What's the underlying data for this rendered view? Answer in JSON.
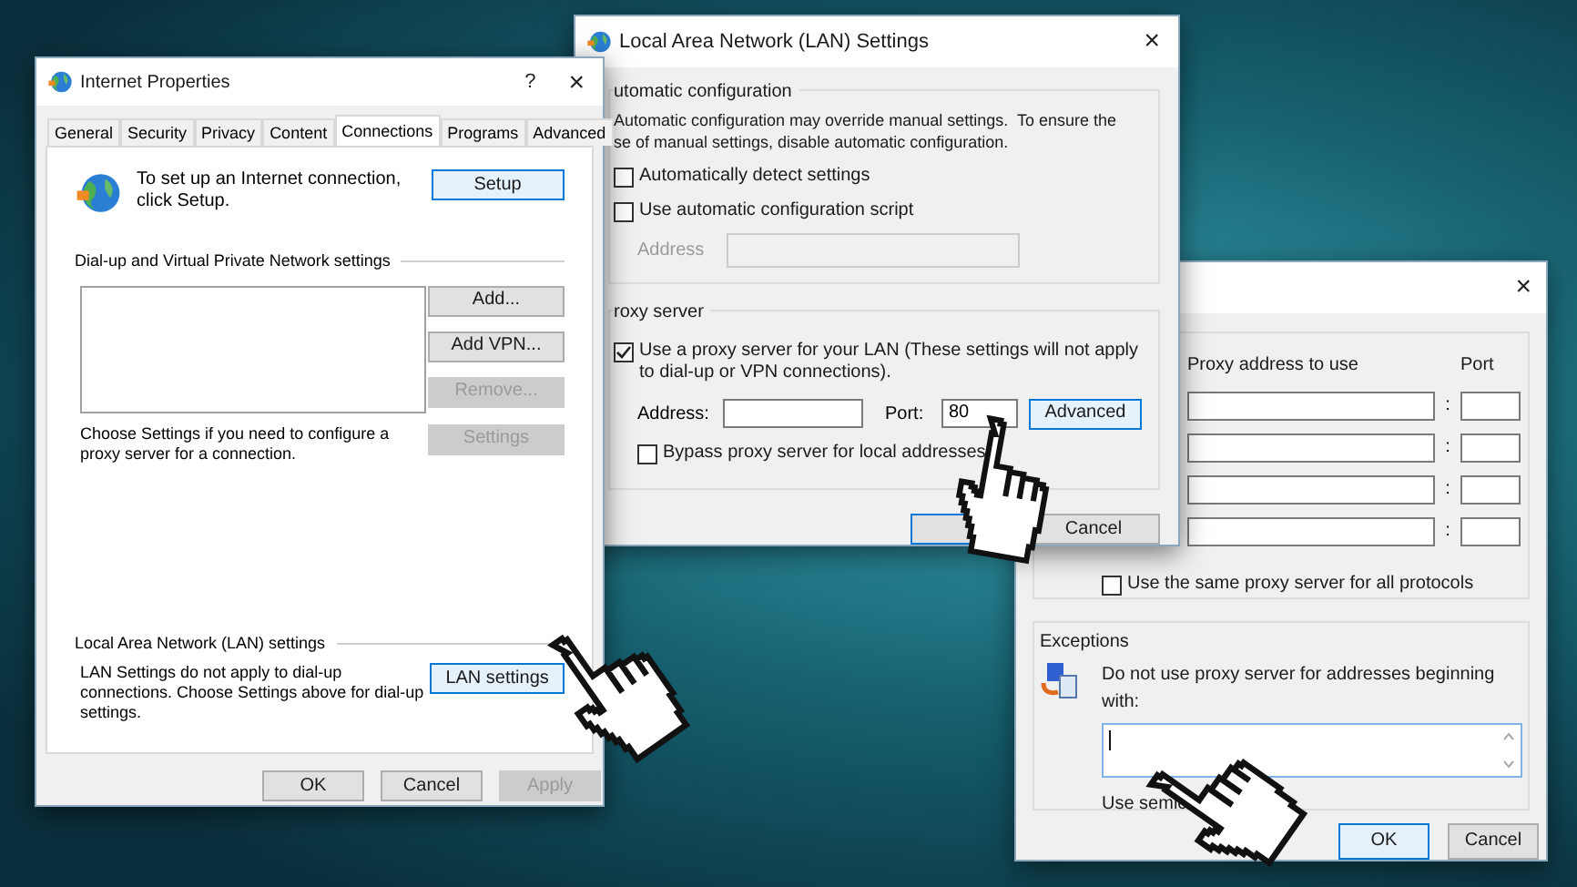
{
  "internet_properties": {
    "title": "Internet Properties",
    "help": "?",
    "close": "×",
    "tabs": [
      {
        "label": "General",
        "selected": false
      },
      {
        "label": "Security",
        "selected": false
      },
      {
        "label": "Privacy",
        "selected": false
      },
      {
        "label": "Content",
        "selected": false
      },
      {
        "label": "Connections",
        "selected": true
      },
      {
        "label": "Programs",
        "selected": false
      },
      {
        "label": "Advanced",
        "selected": false
      }
    ],
    "setup_text": "To set up an Internet connection, click Setup.",
    "setup_button": "Setup",
    "dialup_heading": "Dial-up and Virtual Private Network settings",
    "dialup_buttons": [
      {
        "label": "Add...",
        "disabled": false
      },
      {
        "label": "Add VPN...",
        "disabled": false
      },
      {
        "label": "Remove...",
        "disabled": true
      },
      {
        "label": "Settings",
        "disabled": true
      }
    ],
    "proxy_hint": "Choose Settings if you need to configure a proxy server for a connection.",
    "lan_heading": "Local Area Network (LAN) settings",
    "lan_text": "LAN Settings do not apply to dial-up connections. Choose Settings above for dial-up settings.",
    "lan_button": "LAN settings",
    "footer_buttons": [
      {
        "label": "OK",
        "disabled": false
      },
      {
        "label": "Cancel",
        "disabled": false
      },
      {
        "label": "Apply",
        "disabled": true
      }
    ]
  },
  "lan_settings": {
    "title": "Local Area Network (LAN) Settings",
    "close": "×",
    "auto_heading": "utomatic configuration",
    "auto_text": [
      "Automatic configuration may override manual settings.  To ensure the",
      "se of manual settings, disable automatic configuration."
    ],
    "options": [
      {
        "label": "Automatically detect settings",
        "checked": false
      },
      {
        "label": "Use automatic configuration script",
        "checked": false
      }
    ],
    "address_label": "Address",
    "address_disabled": true,
    "proxy_heading": "roxy server",
    "use_proxy": {
      "label": "Use a proxy server for your LAN (These settings will not apply to dial-up or VPN connections).",
      "checked": true
    },
    "address_field_label": "Address:",
    "port_label": "Port:",
    "port_value": "80",
    "advanced_button": "Advanced",
    "bypass": {
      "label": "Bypass proxy server for local addresses",
      "checked": false
    },
    "cancel_button": "Cancel"
  },
  "proxy_settings": {
    "close": "×",
    "columns": [
      "Proxy address to use",
      "Port"
    ],
    "rows": [
      {
        "separator": ":"
      },
      {
        "separator": ":"
      },
      {
        "separator": ":"
      },
      {
        "separator": ":"
      }
    ],
    "same_proxy": {
      "label": "Use the same proxy server for all protocols",
      "checked": false
    },
    "exceptions_heading": "Exceptions",
    "exceptions_text": "Do not use proxy server for addresses beginning with:",
    "exceptions_note": "Use semic",
    "buttons": [
      "OK",
      "Cancel"
    ]
  }
}
